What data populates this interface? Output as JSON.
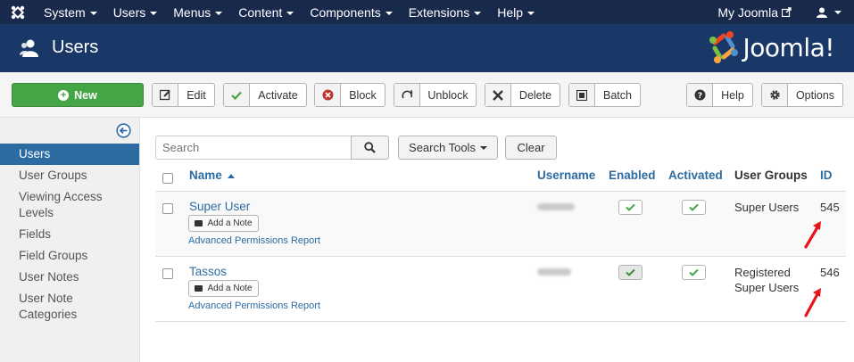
{
  "navbar": {
    "menu": [
      "System",
      "Users",
      "Menus",
      "Content",
      "Components",
      "Extensions",
      "Help"
    ],
    "site_link": "My Joomla"
  },
  "header": {
    "title": "Users",
    "brand": "Joomla!"
  },
  "toolbar": {
    "new": "New",
    "edit": "Edit",
    "activate": "Activate",
    "block": "Block",
    "unblock": "Unblock",
    "delete": "Delete",
    "batch": "Batch",
    "help": "Help",
    "options": "Options"
  },
  "sidebar": {
    "items": [
      {
        "label": "Users",
        "active": true
      },
      {
        "label": "User Groups"
      },
      {
        "label": "Viewing Access Levels"
      },
      {
        "label": "Fields"
      },
      {
        "label": "Field Groups"
      },
      {
        "label": "User Notes"
      },
      {
        "label": "User Note Categories"
      }
    ]
  },
  "filters": {
    "search_placeholder": "Search",
    "search_tools": "Search Tools",
    "clear": "Clear"
  },
  "table": {
    "columns": {
      "name": "Name",
      "username": "Username",
      "enabled": "Enabled",
      "activated": "Activated",
      "groups": "User Groups",
      "id": "ID"
    },
    "rows": [
      {
        "name": "Super User",
        "note_button": "Add a Note",
        "permissions_link": "Advanced Permissions Report",
        "groups": [
          "Super Users"
        ],
        "id": "545"
      },
      {
        "name": "Tassos",
        "note_button": "Add a Note",
        "permissions_link": "Advanced Permissions Report",
        "groups": [
          "Registered",
          "Super Users"
        ],
        "id": "546"
      }
    ]
  },
  "colors": {
    "navbar": "#18294b",
    "header": "#1a3867",
    "link": "#2d6ca2",
    "new_button": "#46a546",
    "annotation_arrow": "#e8141b"
  }
}
